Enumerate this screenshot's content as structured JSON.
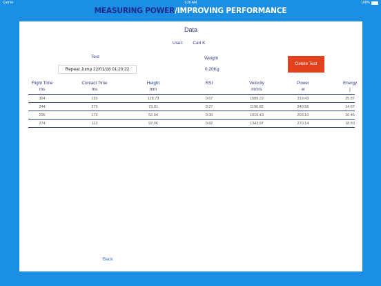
{
  "status_bar": {
    "carrier": "Carrier",
    "time": "1:26 AM",
    "battery": "100%"
  },
  "app_title": {
    "part1": "MEASURING POWER",
    "separator": "/",
    "part2": "IMPROVING PERFORMANCE"
  },
  "page": {
    "title": "Data"
  },
  "user": {
    "label": "User:",
    "value": "Carl K"
  },
  "test": {
    "label": "Test",
    "selected": "Repeat Jump 22/01/18 01:20:22"
  },
  "weight": {
    "label": "Weight",
    "value": "0.20Kg"
  },
  "delete_button": {
    "label": "Delete Test"
  },
  "table": {
    "columns": [
      {
        "name": "Flight Time",
        "unit": "ms"
      },
      {
        "name": "Contact Time",
        "unit": "ms"
      },
      {
        "name": "Height",
        "unit": "mm"
      },
      {
        "name": "RSI",
        "unit": ""
      },
      {
        "name": "Velocity",
        "unit": "mm/s"
      },
      {
        "name": "Power",
        "unit": "w"
      },
      {
        "name": "Energy",
        "unit": "j"
      }
    ],
    "rows": [
      [
        "324",
        "193",
        "128.73",
        "0.67",
        "1589.22",
        "319.43",
        "25.87"
      ],
      [
        "244",
        "273",
        "73.01",
        "0.27",
        "1196.82",
        "240.56",
        "14.67"
      ],
      [
        "206",
        "173",
        "52.04",
        "0.30",
        "1010.43",
        "203.10",
        "10.46"
      ],
      [
        "274",
        "112",
        "92.06",
        "0.82",
        "1343.97",
        "270.14",
        "18.50"
      ]
    ]
  },
  "back_link": {
    "label": "Back"
  },
  "colors": {
    "background": "#1a8fe3",
    "title_dark": "#1d2b8f",
    "delete": "#e3421f",
    "text": "#2d3a7c",
    "link": "#2f6fd6"
  }
}
